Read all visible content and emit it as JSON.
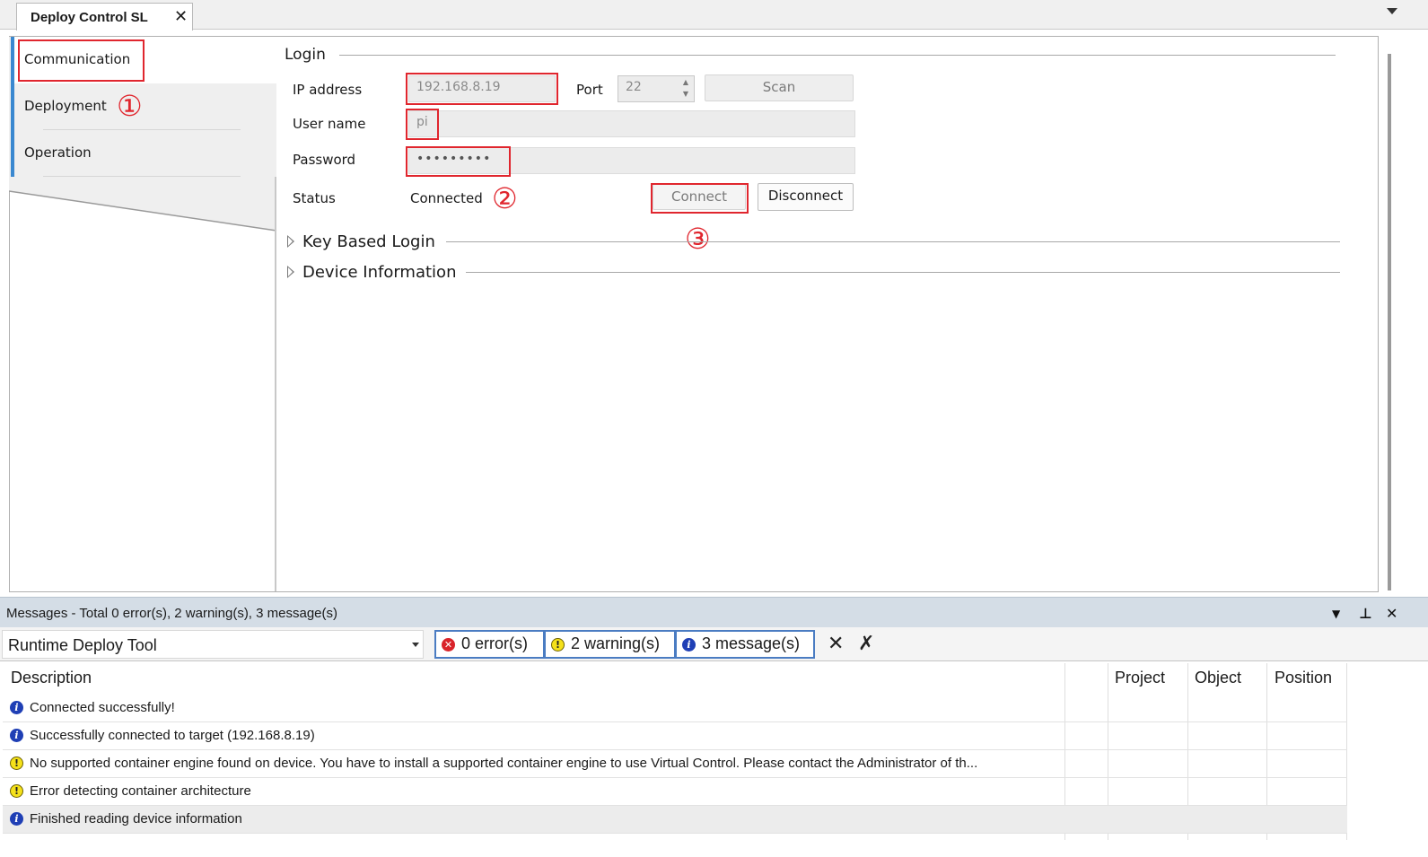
{
  "document_tab": {
    "title": "Deploy Control SL",
    "close_glyph": "✕"
  },
  "sidenav": {
    "items": [
      {
        "label": "Communication"
      },
      {
        "label": "Deployment"
      },
      {
        "label": "Operation"
      }
    ]
  },
  "annotations": {
    "step1": "①",
    "step2": "②",
    "step3": "③"
  },
  "login": {
    "title": "Login",
    "ip_label": "IP address",
    "ip_value": "192.168.8.19",
    "port_label": "Port",
    "port_value": "22",
    "scan_label": "Scan",
    "username_label": "User name",
    "username_value": "pi",
    "password_label": "Password",
    "password_value": "•••••••••",
    "status_label": "Status",
    "status_value": "Connected",
    "connect_label": "Connect",
    "disconnect_label": "Disconnect"
  },
  "sections": {
    "key_based_login": "Key Based Login",
    "device_information": "Device Information"
  },
  "messages": {
    "header_title": "Messages - Total 0 error(s), 2 warning(s), 3 message(s)",
    "source": "Runtime Deploy Tool",
    "errors_label": "0 error(s)",
    "warnings_label": "2 warning(s)",
    "messages_label": "3 message(s)",
    "columns": {
      "description": "Description",
      "project": "Project",
      "object": "Object",
      "position": "Position"
    },
    "rows": [
      {
        "type": "info",
        "description": "Connected successfully!"
      },
      {
        "type": "info",
        "description": "Successfully connected to target (192.168.8.19)"
      },
      {
        "type": "warning",
        "description": "No supported container engine found on device. You have to install a supported container engine to use Virtual Control. Please contact the Administrator of th..."
      },
      {
        "type": "warning",
        "description": "Error detecting container architecture"
      },
      {
        "type": "info",
        "description": "Finished reading device information"
      }
    ]
  },
  "colors": {
    "annotation_red": "#e0262e",
    "nav_accent": "#3a88d0",
    "filter_border": "#4a7cc2",
    "info_blue": "#1f3fb5",
    "warning_yellow": "#f5e11a",
    "error_red": "#d9232a"
  },
  "icons": {
    "info": "info-icon",
    "warning": "warning-icon",
    "error": "error-icon"
  }
}
